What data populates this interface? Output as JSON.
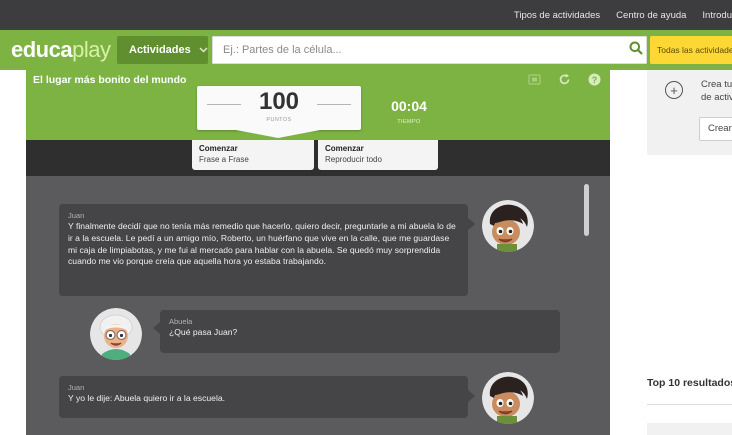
{
  "topbar": {
    "links": [
      "Tipos de actividades",
      "Centro de ayuda",
      "Introdu"
    ]
  },
  "header": {
    "logo_main": "educa",
    "logo_accent": "play",
    "activities_label": "Actividades",
    "search_placeholder": "Ej.: Partes de la célula...",
    "categories_label": "Todas las actividades",
    "colors": {
      "green": "#7cb342",
      "dark_green": "#5f8f2e",
      "yellow": "#fdd835",
      "topbar": "#3d3d3f"
    }
  },
  "activity": {
    "title": "El lugar más bonito del mundo",
    "toolbar_icons": [
      "fullscreen-icon",
      "restart-icon",
      "help-icon"
    ],
    "score": {
      "value": "100",
      "label": "PUNTOS"
    },
    "time": {
      "value": "00:04",
      "label": "TIEMPO"
    },
    "controls": [
      {
        "title": "Comenzar",
        "subtitle": "Frase a Frase"
      },
      {
        "title": "Comenzar",
        "subtitle": "Reproducir todo"
      }
    ],
    "messages": [
      {
        "speaker": "Juan",
        "text": "Y finalmente decidí que no tenía más remedio que hacerlo, quiero decir, preguntarle a mi abuela lo de ir a la escuela. Le pedí a un amigo mío, Roberto, un huérfano que vive en la calle, que me guardase mi caja de limpiabotas, y me fui al mercado para hablar con la abuela. Se quedó muy sorprendida cuando me vio porque creía que aquella hora yo estaba trabajando."
      },
      {
        "speaker": "Abuela",
        "text": "¿Qué pasa Juan?"
      },
      {
        "speaker": "Juan",
        "text": "Y yo le dije:  Abuela quiero ir a la escuela."
      }
    ]
  },
  "sidebar": {
    "create_text_1": "Crea tu",
    "create_text_2": "de activ",
    "create_button": "Crear",
    "top10_title": "Top 10 resultados"
  }
}
